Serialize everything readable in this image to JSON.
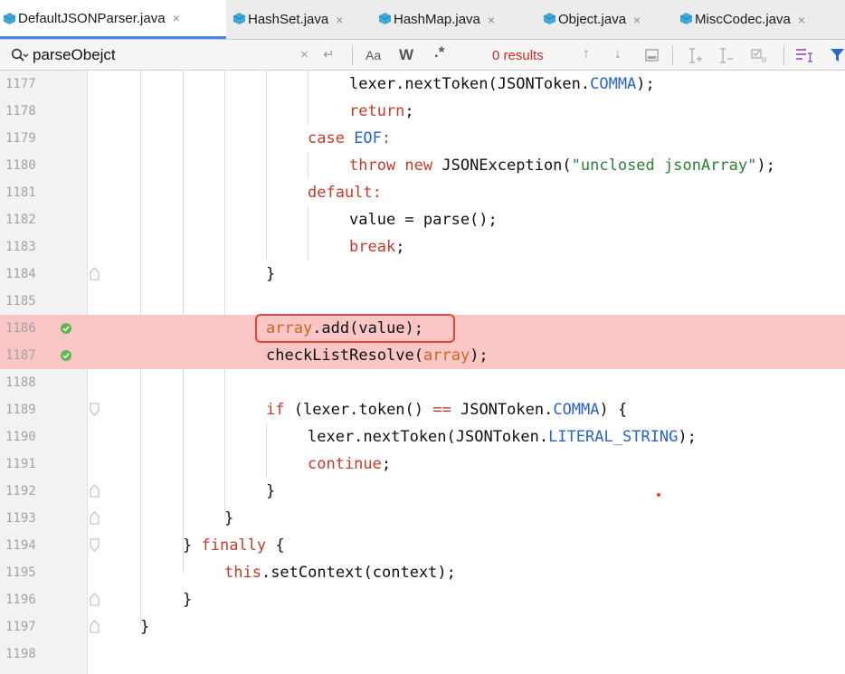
{
  "tabs": [
    {
      "label": "DefaultJSONParser.java",
      "active": true
    },
    {
      "label": "HashSet.java",
      "active": false
    },
    {
      "label": "HashMap.java",
      "active": false
    },
    {
      "label": "Object.java",
      "active": false
    },
    {
      "label": "MiscCodec.java",
      "active": false
    }
  ],
  "tab_close_glyph": "×",
  "search": {
    "value": "parseObejct",
    "results": "0 results",
    "match_case_label": "Aa",
    "words_label": "W",
    "regex_label": ".*",
    "clear_glyph": "×",
    "enter_glyph": "↵",
    "prev_glyph": "↑",
    "next_glyph": "↓"
  },
  "lines": [
    {
      "num": "1177"
    },
    {
      "num": "1178"
    },
    {
      "num": "1179"
    },
    {
      "num": "1180"
    },
    {
      "num": "1181"
    },
    {
      "num": "1182"
    },
    {
      "num": "1183"
    },
    {
      "num": "1184"
    },
    {
      "num": "1185"
    },
    {
      "num": "1186"
    },
    {
      "num": "1187"
    },
    {
      "num": "1188"
    },
    {
      "num": "1189"
    },
    {
      "num": "1190"
    },
    {
      "num": "1191"
    },
    {
      "num": "1192"
    },
    {
      "num": "1193"
    },
    {
      "num": "1194"
    },
    {
      "num": "1195"
    },
    {
      "num": "1196"
    },
    {
      "num": "1197"
    },
    {
      "num": "1198"
    }
  ],
  "code": {
    "l1177": {
      "a": "lexer.nextToken(JSONToken.",
      "b": "COMMA",
      "c": ");"
    },
    "l1178": {
      "a": "return",
      "b": ";"
    },
    "l1179": {
      "a": "case ",
      "b": "EOF",
      "c": ":"
    },
    "l1180": {
      "a": "throw new ",
      "b": "JSONException(",
      "c": "\"unclosed jsonArray\"",
      "d": ");"
    },
    "l1181": {
      "a": "default",
      "b": ":"
    },
    "l1182": {
      "a": "value = parse();"
    },
    "l1183": {
      "a": "break",
      "b": ";"
    },
    "l1184": {
      "a": "}"
    },
    "l1186": {
      "a": "array",
      "b": ".add(value);"
    },
    "l1187": {
      "a": "checkListResolve(",
      "b": "array",
      "c": ");"
    },
    "l1189": {
      "a": "if ",
      "b": "(lexer.token() ",
      "c": "==",
      "d": " JSONToken.",
      "e": "COMMA",
      "f": ") {"
    },
    "l1190": {
      "a": "lexer.nextToken(JSONToken.",
      "b": "LITERAL_STRING",
      "c": ");"
    },
    "l1191": {
      "a": "continue",
      "b": ";"
    },
    "l1192": {
      "a": "}"
    },
    "l1193": {
      "a": "}"
    },
    "l1194": {
      "a": "} ",
      "b": "finally",
      "c": " {"
    },
    "l1195": {
      "a": "this",
      "b": ".setContext(context);"
    },
    "l1196": {
      "a": "}"
    },
    "l1197": {
      "a": "}"
    }
  },
  "colors": {
    "keyword": "#c53a2a",
    "constant": "#2863c8",
    "string": "#2a7f35",
    "field": "#c46a1b",
    "breakpoint_line": "#fac5c5",
    "highlight_box": "#e0463a",
    "active_tab_underline": "#4a86e8"
  }
}
